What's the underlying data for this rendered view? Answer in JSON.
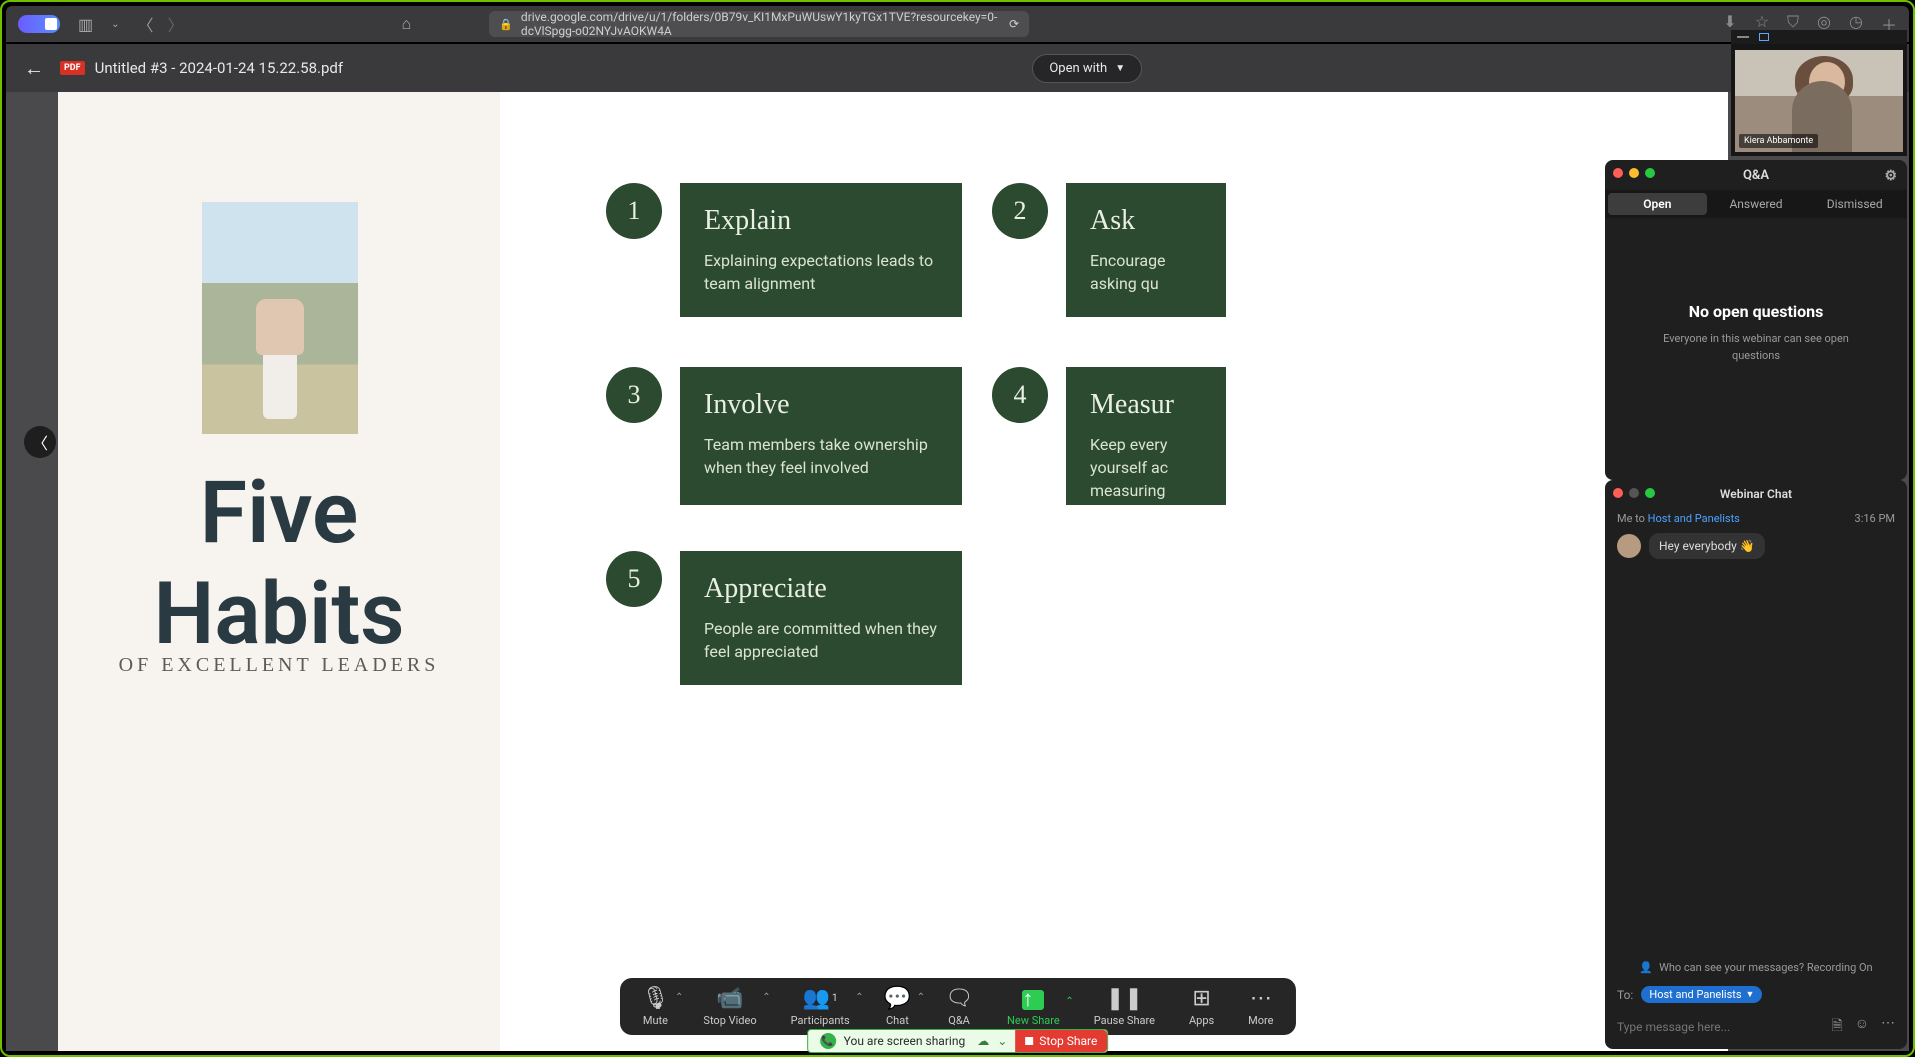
{
  "browser": {
    "url": "drive.google.com/drive/u/1/folders/0B79v_KI1MxPuWUswY1kyTGx1TVE?resourcekey=0-dcVlSpgg-o02NYJvAOKW4A"
  },
  "drive": {
    "filename": "Untitled #3 - 2024-01-24 15.22.58.pdf",
    "pdf_badge": "PDF",
    "open_with": "Open with"
  },
  "slide": {
    "title_line1": "Five",
    "title_line2": "Habits",
    "subtitle": "OF EXCELLENT LEADERS",
    "habits": [
      {
        "n": "1",
        "h": "Explain",
        "p": "Explaining expectations leads to team alignment"
      },
      {
        "n": "2",
        "h": "Ask",
        "p": "Encourage asking qu"
      },
      {
        "n": "3",
        "h": "Involve",
        "p": "Team members take ownership when they feel involved"
      },
      {
        "n": "4",
        "h": "Measur",
        "p": "Keep every yourself ac measuring"
      },
      {
        "n": "5",
        "h": "Appreciate",
        "p": "People are committed when they feel appreciated"
      }
    ]
  },
  "zoom_toolbar": {
    "items": [
      {
        "label": "Mute"
      },
      {
        "label": "Stop Video"
      },
      {
        "label": "Participants",
        "count": "1"
      },
      {
        "label": "Chat"
      },
      {
        "label": "Q&A"
      },
      {
        "label": "New Share"
      },
      {
        "label": "Pause Share"
      },
      {
        "label": "Apps"
      },
      {
        "label": "More"
      }
    ],
    "sharing_text": "You are screen sharing",
    "stop_share": "Stop Share"
  },
  "video": {
    "name": "Kiera Abbamonte"
  },
  "qa": {
    "title": "Q&A",
    "tabs": [
      "Open",
      "Answered",
      "Dismissed"
    ],
    "empty_title": "No open questions",
    "empty_sub": "Everyone in this webinar can see open questions"
  },
  "chat": {
    "title": "Webinar Chat",
    "from": "Me to ",
    "recipients": "Host and Panelists",
    "time": "3:16 PM",
    "msg": "Hey everybody 👋",
    "notice": "Who can see your messages? Recording On",
    "to_label": "To:",
    "to_value": "Host and Panelists",
    "placeholder": "Type message here..."
  }
}
